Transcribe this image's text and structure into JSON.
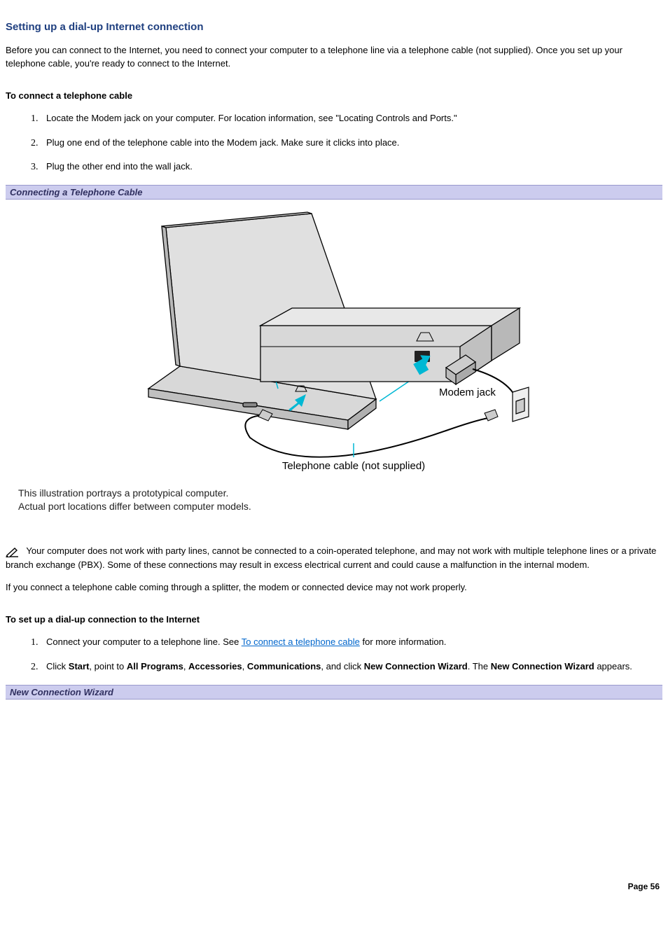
{
  "heading": "Setting up a dial-up Internet connection",
  "intro": "Before you can connect to the Internet, you need to connect your computer to a telephone line via a telephone cable (not supplied). Once you set up your telephone cable, you're ready to connect to the Internet.",
  "sectionA": {
    "title": "To connect a telephone cable",
    "steps": [
      "Locate the Modem jack on your computer. For location information, see \"Locating Controls and Ports.\"",
      "Plug one end of the telephone cable into the Modem jack. Make sure it clicks into place.",
      "Plug the other end into the wall jack."
    ]
  },
  "figure1": {
    "caption": "Connecting a Telephone Cable",
    "label_modem": "Modem jack",
    "label_cable": "Telephone cable (not supplied)",
    "note_line1": "This illustration portrays a prototypical computer.",
    "note_line2": "Actual port locations differ between computer models."
  },
  "note1": "Your computer does not work with party lines, cannot be connected to a coin-operated telephone, and may not work with multiple telephone lines or a private branch exchange (PBX). Some of these connections may result in excess electrical current and could cause a malfunction in the internal modem.",
  "note2": "If you connect a telephone cable coming through a splitter, the modem or connected device may not work properly.",
  "sectionB": {
    "title": "To set up a dial-up connection to the Internet",
    "step1_prefix": "Connect your computer to a telephone line. See ",
    "step1_link": "To connect a telephone cable",
    "step1_suffix": " for more information.",
    "step2": {
      "pre": "Click ",
      "b1": "Start",
      "t1": ", point to ",
      "b2": "All Programs",
      "t2": ", ",
      "b3": "Accessories",
      "t3": ", ",
      "b4": "Communications",
      "t4": ", and click ",
      "b5": "New Connection Wizard",
      "t5": ". The ",
      "b6": "New Connection Wizard",
      "t6": " appears."
    }
  },
  "figure2": {
    "caption": "New Connection Wizard"
  },
  "page_number": "Page 56"
}
